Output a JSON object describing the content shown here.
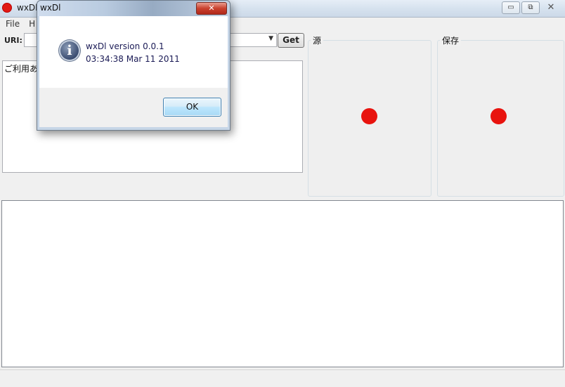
{
  "window": {
    "title": "wxDl",
    "minimize_glyph": "▭",
    "restore_glyph": "⧉",
    "close_glyph": "✕"
  },
  "menu": {
    "items": [
      "File",
      "H"
    ]
  },
  "uri": {
    "label": "URI:",
    "value": ""
  },
  "get_button": {
    "label": "Get"
  },
  "info_text": "ご利用あり",
  "source_group": {
    "label": "源",
    "indicator_color": "#e8130e"
  },
  "save_group": {
    "label": "保存",
    "indicator_color": "#e8130e"
  },
  "dialog": {
    "title": "wxDl",
    "close_glyph": "✕",
    "icon_glyph": "i",
    "line1": "wxDl version 0.0.1",
    "line2": "03:34:38 Mar 11 2011",
    "ok_label": "OK"
  },
  "colors": {
    "accent": "#3c7fb1",
    "status_red": "#e8130e"
  }
}
